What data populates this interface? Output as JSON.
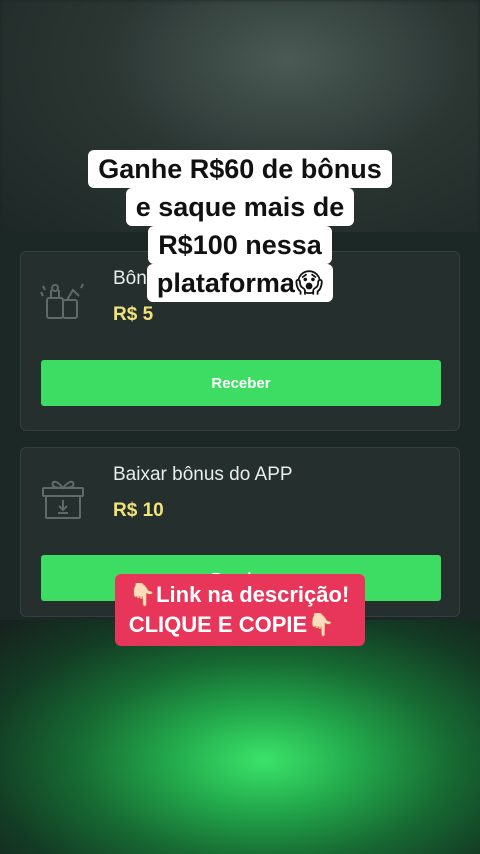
{
  "background": {
    "accent": "#3ddc63",
    "card_bg": "#25302e",
    "amount_color": "#f1e27a"
  },
  "cards": [
    {
      "title": "Bônus",
      "title_visible": "Bôn",
      "amount": "R$ 5",
      "button": "Receber",
      "icon": "gift-box-icon"
    },
    {
      "title": "Baixar bônus do APP",
      "amount": "R$ 10",
      "button": "Receber",
      "icon": "gift-download-icon"
    }
  ],
  "overlay_caption": {
    "lines": [
      "Ganhe R$60 de bônus",
      "e saque mais de",
      "R$100 nessa",
      "plataforma😱"
    ]
  },
  "promo_caption": {
    "lines": [
      "👇🏻Link na descrição!",
      "CLIQUE E COPIE👇🏻"
    ],
    "color": "#e8365a"
  }
}
